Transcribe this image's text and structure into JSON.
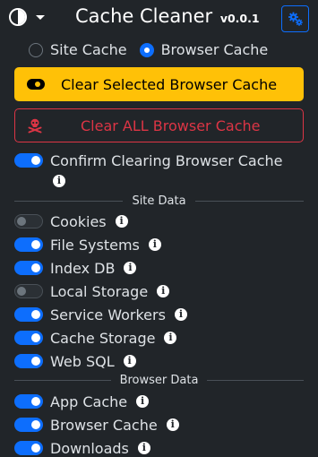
{
  "header": {
    "title": "Cache Cleaner",
    "version": "v0.0.1"
  },
  "mode": {
    "options": [
      "Site Cache",
      "Browser Cache"
    ],
    "selected": "Browser Cache"
  },
  "actions": {
    "clear_selected": "Clear Selected Browser Cache",
    "clear_all": "Clear ALL Browser Cache"
  },
  "confirm": {
    "label": "Confirm Clearing Browser Cache",
    "enabled": true
  },
  "site_data": {
    "heading": "Site Data",
    "items": [
      {
        "label": "Cookies",
        "enabled": false
      },
      {
        "label": "File Systems",
        "enabled": true
      },
      {
        "label": "Index DB",
        "enabled": true
      },
      {
        "label": "Local Storage",
        "enabled": false
      },
      {
        "label": "Service Workers",
        "enabled": true
      },
      {
        "label": "Cache Storage",
        "enabled": true
      },
      {
        "label": "Web SQL",
        "enabled": true
      }
    ]
  },
  "browser_data": {
    "heading": "Browser Data",
    "items": [
      {
        "label": "App Cache",
        "enabled": true
      },
      {
        "label": "Browser Cache",
        "enabled": true
      },
      {
        "label": "Downloads",
        "enabled": true
      }
    ]
  },
  "colors": {
    "background": "#212529",
    "accent": "#0d6efd",
    "warning": "#ffc107",
    "danger": "#dc3545"
  },
  "icons": [
    "theme-toggle-icon",
    "chevron-down-icon",
    "settings-gears-icon",
    "toggle-icon",
    "skull-crossbones-icon",
    "info-icon"
  ]
}
